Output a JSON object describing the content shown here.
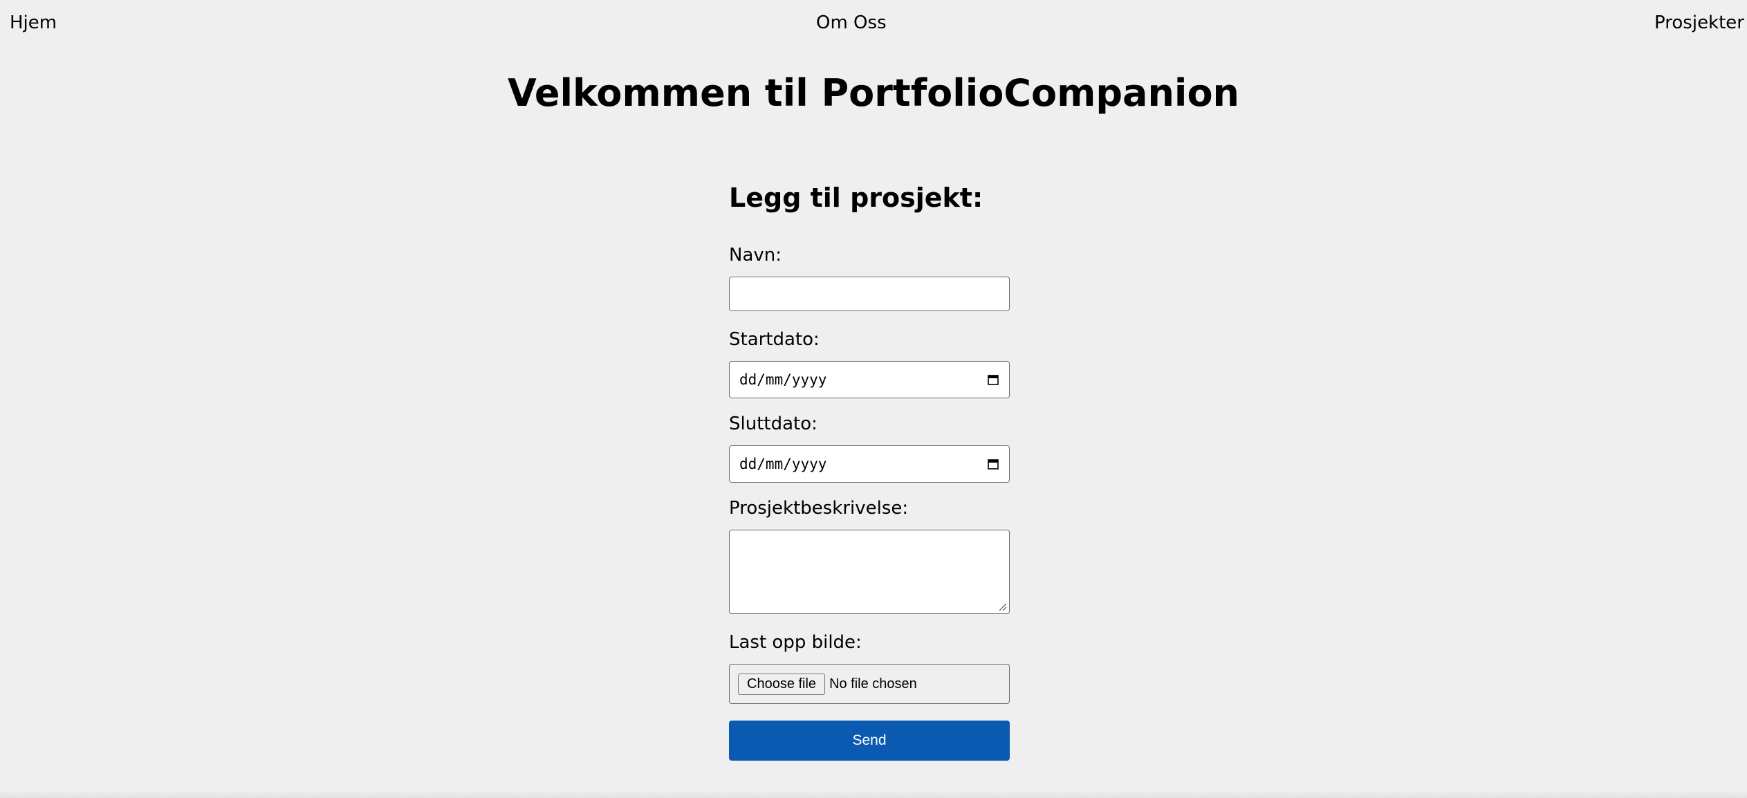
{
  "nav": {
    "home": "Hjem",
    "about": "Om Oss",
    "projects": "Prosjekter"
  },
  "header": {
    "title": "Velkommen til PortfolioCompanion"
  },
  "form": {
    "title": "Legg til prosjekt:",
    "name_label": "Navn:",
    "name_value": "",
    "start_label": "Startdato:",
    "start_placeholder": "dd/mm/yyyy",
    "end_label": "Sluttdato:",
    "end_placeholder": "dd/mm/yyyy",
    "description_label": "Prosjektbeskrivelse:",
    "upload_label": "Last opp bilde:",
    "choose_file": "Choose file",
    "no_file": "No file chosen",
    "send": "Send"
  },
  "colors": {
    "background": "#efefef",
    "button": "#0b5ab2"
  }
}
